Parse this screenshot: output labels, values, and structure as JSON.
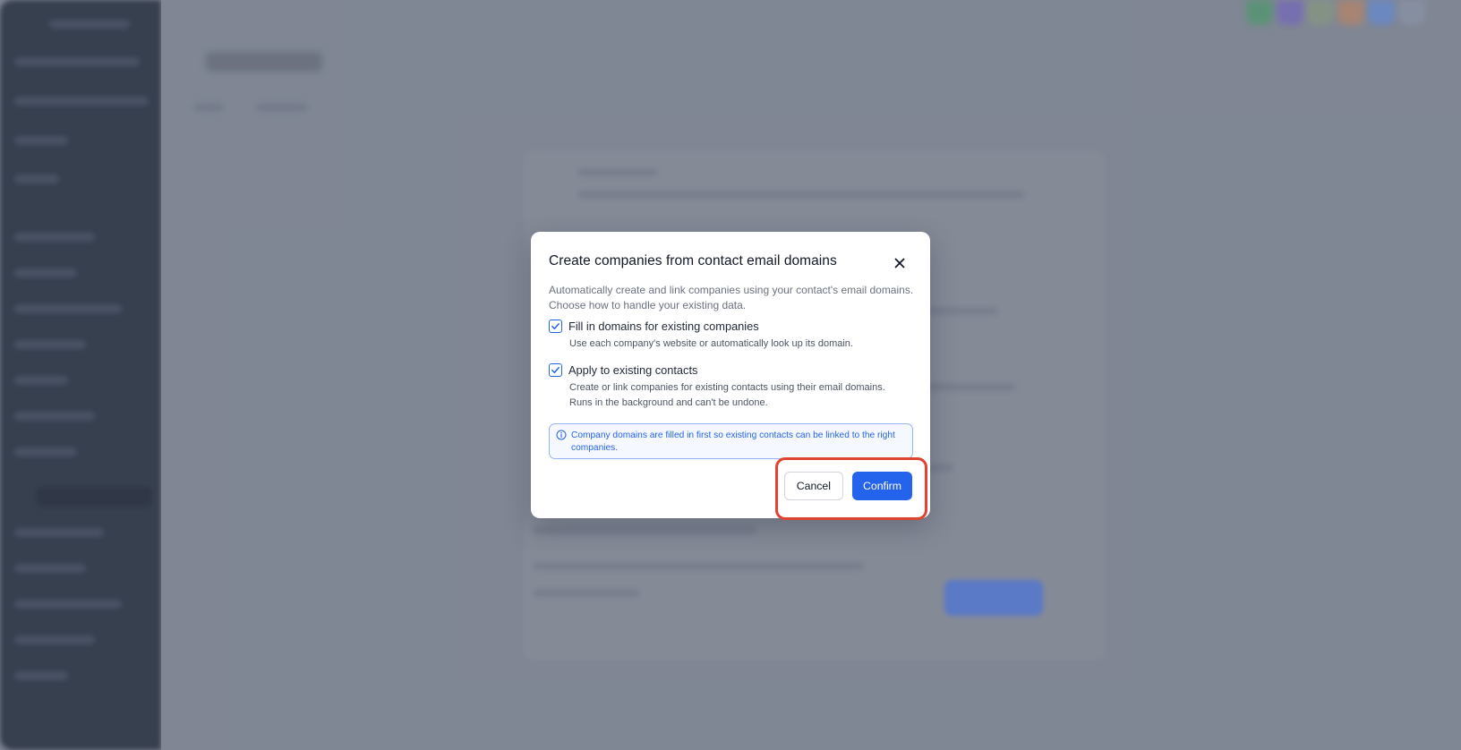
{
  "dialog": {
    "title": "Create companies from contact email domains",
    "description": "Automatically create and link companies using your contact's email domains. Choose how to handle your existing data.",
    "options": [
      {
        "label": "Fill in domains for existing companies",
        "help": "Use each company's website or automatically look up its domain.",
        "checked": true
      },
      {
        "label": "Apply to existing contacts",
        "help_line1": "Create or link companies for existing contacts using their email domains.",
        "help_line2": "Runs in the background and can't be undone.",
        "checked": true
      }
    ],
    "info": "Company domains are filled in first so existing contacts can be linked to the right companies.",
    "cancel_label": "Cancel",
    "confirm_label": "Confirm",
    "close_icon": "close-icon",
    "info_icon": "info-circle-icon",
    "check_icon": "checkmark-icon"
  },
  "colors": {
    "accent": "#2463eb",
    "highlight": "#e0432f",
    "sidebar": "#36404f",
    "backdrop": "#868d99"
  }
}
